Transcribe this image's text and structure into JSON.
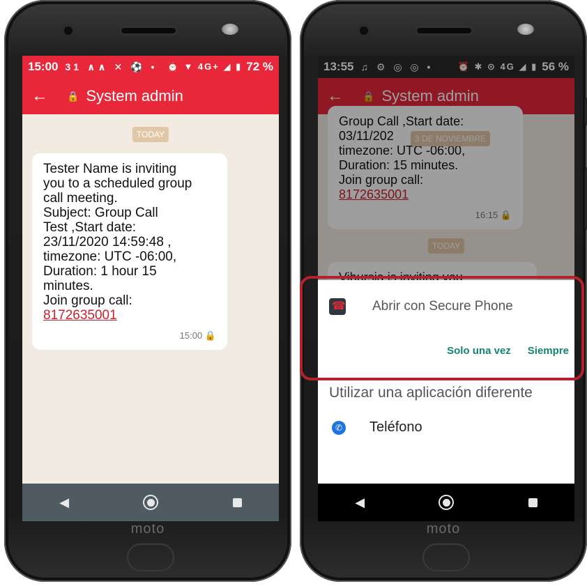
{
  "left": {
    "status": {
      "time": "15:00",
      "notif_icons": "31 ∧∧ ✕ ⚽ •",
      "sys_icons": "⏰ ▼ 4G+ ◢ ▮",
      "battery": "72 %"
    },
    "appbar": {
      "title": "System admin",
      "color": "#e8283a"
    },
    "date_chip": "TODAY",
    "message": {
      "lines": [
        "Tester Name is inviting",
        "you to a scheduled group",
        "call meeting.",
        "Subject: Group Call",
        "Test ,Start date:",
        "23/11/2020 14:59:48 ,",
        "timezone: UTC -06:00,",
        "Duration: 1 hour 15",
        "minutes.",
        "Join group call:"
      ],
      "link": "8172635001",
      "time": "15:00 🔒"
    }
  },
  "right": {
    "status": {
      "time": "13:55",
      "notif_icons": "♫ ⚙ ◎ ◎ •",
      "sys_icons": "⏰ ✱ ⊙ 4G ◢ ▮",
      "battery": "56 %"
    },
    "appbar": {
      "title": "System admin",
      "color": "#c01e2c"
    },
    "date_chip_top": "3 DE NOVIEMBRE",
    "prev_message": {
      "lines": [
        "Group Call ,Start date:",
        "03/11/202",
        "timezone: UTC -06:00,",
        "Duration:  15 minutes.",
        "Join group call:"
      ],
      "link": "8172635001",
      "time": "16:15 🔒"
    },
    "date_chip": "TODAY",
    "partial_text": "Vibursia is inviting you",
    "sheet": {
      "title": "Abrir con Secure Phone",
      "once": "Solo una vez",
      "always": "Siempre",
      "alt_title": "Utilizar una aplicación diferente",
      "item_label": "Teléfono"
    }
  },
  "brand": "moto",
  "colors": {
    "accent_red": "#e8283a",
    "action_teal": "#17836f",
    "highlight": "#b4202b"
  }
}
